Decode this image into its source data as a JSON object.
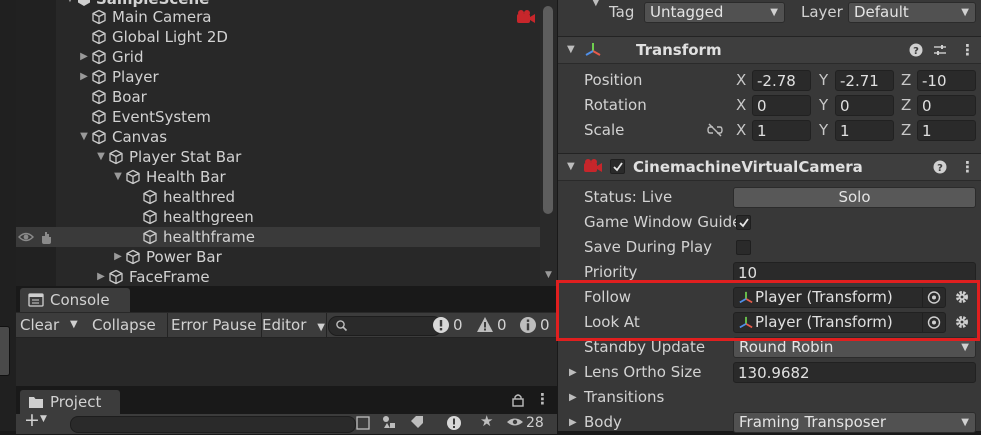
{
  "hierarchy": {
    "scene_name": "SampleScene",
    "items": [
      {
        "label": "Main Camera",
        "indent": 1,
        "arrow": ""
      },
      {
        "label": "Global Light 2D",
        "indent": 1,
        "arrow": ""
      },
      {
        "label": "Grid",
        "indent": 1,
        "arrow": "right"
      },
      {
        "label": "Player",
        "indent": 1,
        "arrow": "right"
      },
      {
        "label": "Boar",
        "indent": 1,
        "arrow": ""
      },
      {
        "label": "EventSystem",
        "indent": 1,
        "arrow": ""
      },
      {
        "label": "Canvas",
        "indent": 1,
        "arrow": "down"
      },
      {
        "label": "Player Stat Bar",
        "indent": 2,
        "arrow": "down"
      },
      {
        "label": "Health Bar",
        "indent": 3,
        "arrow": "down"
      },
      {
        "label": "healthred",
        "indent": 4,
        "arrow": ""
      },
      {
        "label": "healthgreen",
        "indent": 4,
        "arrow": ""
      },
      {
        "label": "healthframe",
        "indent": 4,
        "arrow": "",
        "selected": true
      },
      {
        "label": "Power Bar",
        "indent": 3,
        "arrow": "right"
      },
      {
        "label": "FaceFrame",
        "indent": 2,
        "arrow": "right"
      }
    ]
  },
  "console": {
    "tab_label": "Console",
    "clear_label": "Clear",
    "collapse_label": "Collapse",
    "error_pause_label": "Error Pause",
    "editor_label": "Editor",
    "error_count": "0",
    "warning_count": "0",
    "info_count": "0"
  },
  "project": {
    "tab_label": "Project",
    "count": "28"
  },
  "inspector": {
    "tag_label": "Tag",
    "tag_value": "Untagged",
    "layer_label": "Layer",
    "layer_value": "Default",
    "transform": {
      "title": "Transform",
      "position_label": "Position",
      "rotation_label": "Rotation",
      "scale_label": "Scale",
      "position": {
        "x": "-2.78",
        "y": "-2.71",
        "z": "-10"
      },
      "rotation": {
        "x": "0",
        "y": "0",
        "z": "0"
      },
      "scale": {
        "x": "1",
        "y": "1",
        "z": "1"
      },
      "axis_x": "X",
      "axis_y": "Y",
      "axis_z": "Z"
    },
    "cinemachine": {
      "title": "CinemachineVirtualCamera",
      "status_label": "Status: Live",
      "solo_label": "Solo",
      "game_window_guides_label": "Game Window Guide",
      "game_window_guides_checked": true,
      "save_during_play_label": "Save During Play",
      "save_during_play_checked": false,
      "priority_label": "Priority",
      "priority_value": "10",
      "follow_label": "Follow",
      "follow_value": "Player (Transform)",
      "look_at_label": "Look At",
      "look_at_value": "Player (Transform)",
      "standby_update_label": "Standby Update",
      "standby_update_value": "Round Robin",
      "lens_ortho_label": "Lens Ortho Size",
      "lens_ortho_value": "130.9682",
      "transitions_label": "Transitions",
      "body_label": "Body",
      "body_value": "Framing Transposer"
    }
  },
  "colors": {
    "highlight": "#e01f1f",
    "selection": "#3a3a3a",
    "panel": "#282828",
    "inspector": "#383838"
  }
}
